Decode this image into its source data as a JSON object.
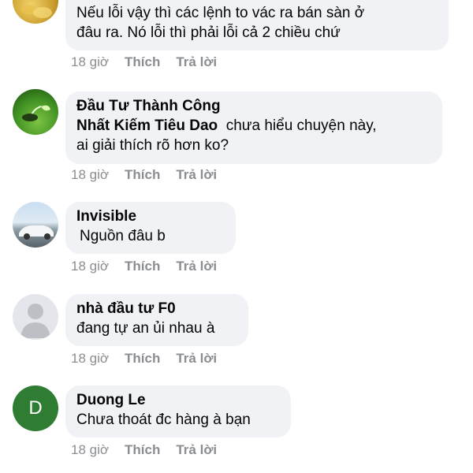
{
  "comments": [
    {
      "author": "",
      "lines": [
        "Nếu lỗi vậy thì các lệnh to vác ra bán sàn ở",
        "đâu ra. Nó lỗi thì phải lỗi cả 2 chiều chứ"
      ],
      "time": "18 giờ",
      "like": "Thích",
      "reply": "Trả lời",
      "avatar": "gold-coins-avatar"
    },
    {
      "author": "Đầu Tư Thành Công",
      "mention": "Nhất Kiếm Tiêu Dao",
      "lines": [
        "chưa hiểu chuyện này,",
        "ai giải thích rõ hơn ko?"
      ],
      "time": "18 giờ",
      "like": "Thích",
      "reply": "Trả lời",
      "avatar": "sprout-avatar"
    },
    {
      "author": "Invisible",
      "lines": [
        "Nguồn đâu b"
      ],
      "time": "18 giờ",
      "like": "Thích",
      "reply": "Trả lời",
      "avatar": "car-avatar"
    },
    {
      "author": "nhà đầu tư F0",
      "lines": [
        "đang tự an ủi nhau à"
      ],
      "time": "18 giờ",
      "like": "Thích",
      "reply": "Trả lời",
      "avatar": "default-user-avatar"
    },
    {
      "author": "Duong Le",
      "lines": [
        "Chưa thoát đc hàng à bạn"
      ],
      "time": "18 giờ",
      "like": "Thích",
      "reply": "Trả lời",
      "avatar": "letter-avatar",
      "avatar_letter": "D",
      "avatar_color": "#2e7d32"
    }
  ]
}
